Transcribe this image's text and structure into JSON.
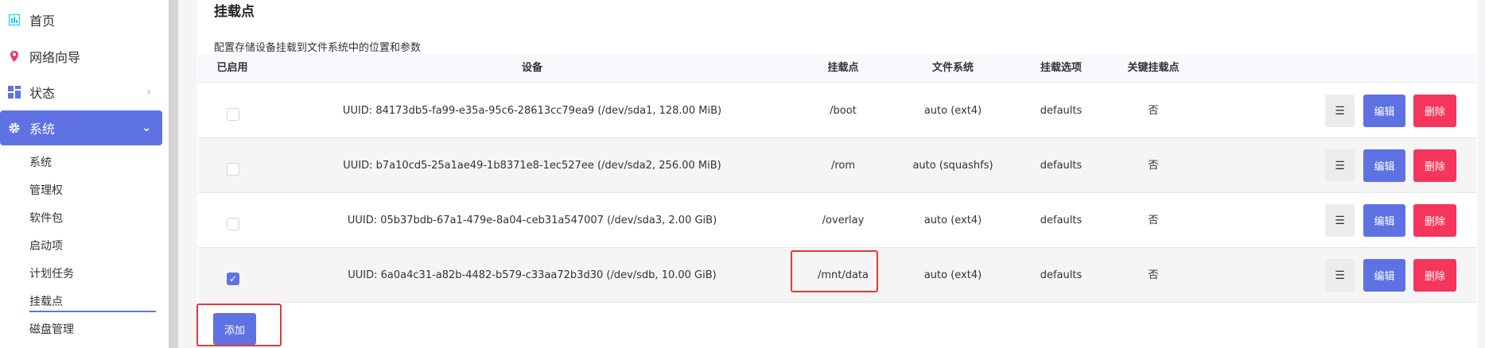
{
  "sidebar": {
    "items": [
      {
        "label": "首页",
        "icon": "dashboard-icon",
        "color": "#11cdef"
      },
      {
        "label": "网络向导",
        "icon": "location-pin-icon",
        "color": "#f5365c"
      },
      {
        "label": "状态",
        "icon": "grid-icon",
        "color": "#5e72e4",
        "chevron": "›"
      },
      {
        "label": "系统",
        "icon": "gear-icon",
        "color": "#ffffff",
        "chevron": "⌄"
      }
    ],
    "sub_items": [
      "系统",
      "管理权",
      "软件包",
      "启动项",
      "计划任务",
      "挂载点",
      "磁盘管理"
    ],
    "current_sub": "挂载点"
  },
  "section": {
    "title": "挂载点",
    "description": "配置存储设备挂载到文件系统中的位置和参数"
  },
  "table": {
    "headers": {
      "enabled": "已启用",
      "device": "设备",
      "mountpoint": "挂载点",
      "filesystem": "文件系统",
      "options": "挂载选项",
      "critical": "关键挂载点"
    },
    "rows": [
      {
        "enabled": false,
        "device": "UUID: 84173db5-fa99-e35a-95c6-28613cc79ea9 (/dev/sda1, 128.00 MiB)",
        "mountpoint": "/boot",
        "filesystem": "auto (ext4)",
        "options": "defaults",
        "critical": "否"
      },
      {
        "enabled": false,
        "device": "UUID: b7a10cd5-25a1ae49-1b8371e8-1ec527ee (/dev/sda2, 256.00 MiB)",
        "mountpoint": "/rom",
        "filesystem": "auto (squashfs)",
        "options": "defaults",
        "critical": "否"
      },
      {
        "enabled": false,
        "device": "UUID: 05b37bdb-67a1-479e-8a04-ceb31a547007 (/dev/sda3, 2.00 GiB)",
        "mountpoint": "/overlay",
        "filesystem": "auto (ext4)",
        "options": "defaults",
        "critical": "否"
      },
      {
        "enabled": true,
        "device": "UUID: 6a0a4c31-a82b-4482-b579-c33aa72b3d30 (/dev/sdb, 10.00 GiB)",
        "mountpoint": "/mnt/data",
        "filesystem": "auto (ext4)",
        "options": "defaults",
        "critical": "否"
      }
    ],
    "actions": {
      "more": "☰",
      "edit": "编辑",
      "delete": "删除"
    }
  },
  "add_button": "添加",
  "colors": {
    "accent": "#5e72e4",
    "danger": "#f5365c",
    "highlight": "#e53935"
  }
}
